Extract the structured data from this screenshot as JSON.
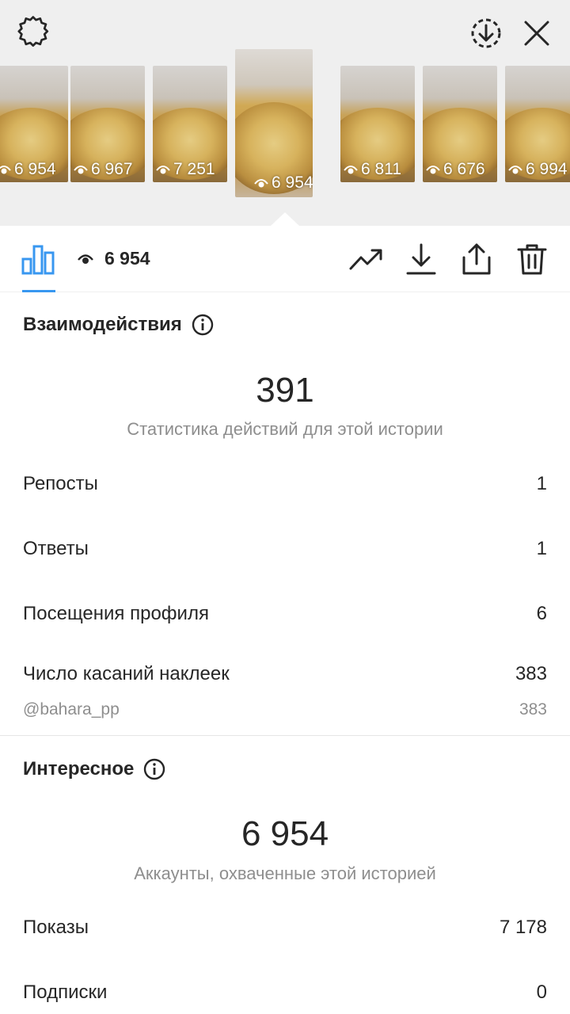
{
  "thumbnails": [
    {
      "views": "6 954"
    },
    {
      "views": "6 967"
    },
    {
      "views": "7 251"
    },
    {
      "views": "6 954"
    },
    {
      "views": "6 811"
    },
    {
      "views": "6 676"
    },
    {
      "views": "6 994"
    }
  ],
  "toolbar": {
    "views": "6 954"
  },
  "interactions": {
    "title": "Взаимодействия",
    "total": "391",
    "subtitle": "Статистика действий для этой истории",
    "rows": [
      {
        "label": "Репосты",
        "value": "1"
      },
      {
        "label": "Ответы",
        "value": "1"
      },
      {
        "label": "Посещения профиля",
        "value": "6"
      },
      {
        "label": "Число касаний наклеек",
        "value": "383"
      }
    ],
    "sticker": {
      "label": "@bahara_pp",
      "value": "383"
    }
  },
  "discovery": {
    "title": "Интересное",
    "total": "6 954",
    "subtitle": "Аккаунты, охваченные этой историей",
    "rows": [
      {
        "label": "Показы",
        "value": "7 178"
      },
      {
        "label": "Подписки",
        "value": "0"
      }
    ]
  },
  "colors": {
    "accent": "#3897f0",
    "text": "#262626",
    "muted": "#8e8e8e"
  }
}
